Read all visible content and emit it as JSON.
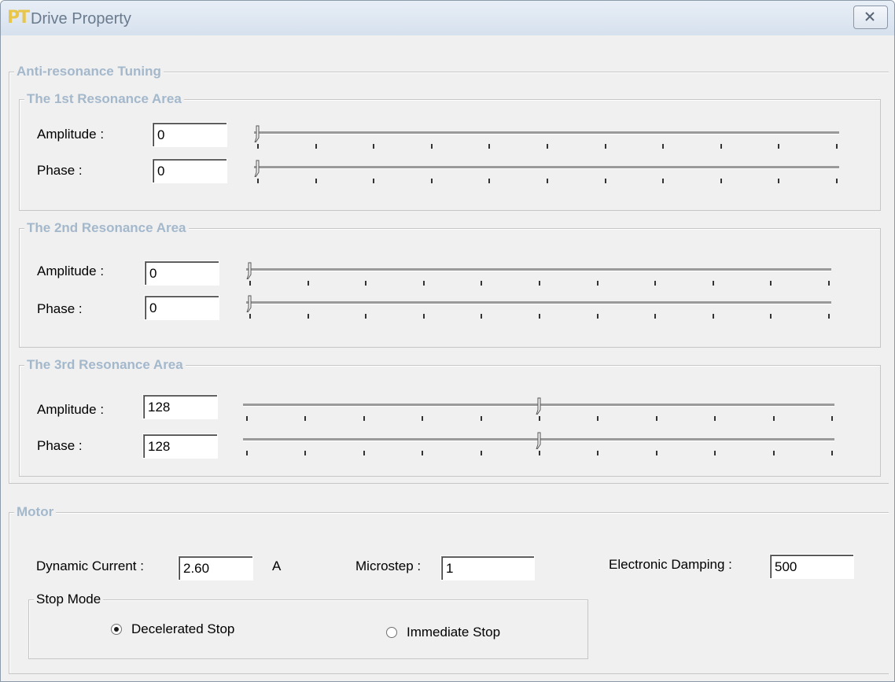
{
  "window": {
    "title": "Drive Property",
    "app_icon_text": "PT"
  },
  "anti_resonance": {
    "title": "Anti-resonance Tuning",
    "areas": [
      {
        "title": "The 1st Resonance Area",
        "amplitude_label": "Amplitude :",
        "amplitude_value": "0",
        "amplitude_level": 0.0,
        "phase_label": "Phase :",
        "phase_value": "0",
        "phase_level": 0.0
      },
      {
        "title": "The 2nd Resonance Area",
        "amplitude_label": "Amplitude :",
        "amplitude_value": "0",
        "amplitude_level": 0.0,
        "phase_label": "Phase :",
        "phase_value": "0",
        "phase_level": 0.0
      },
      {
        "title": "The 3rd Resonance Area",
        "amplitude_label": "Amplitude :",
        "amplitude_value": "128",
        "amplitude_level": 0.5,
        "phase_label": "Phase :",
        "phase_value": "128",
        "phase_level": 0.5
      }
    ]
  },
  "motor": {
    "title": "Motor",
    "dynamic_current_label": "Dynamic Current :",
    "dynamic_current_value": "2.60",
    "dynamic_current_unit": "A",
    "microstep_label": "Microstep :",
    "microstep_value": "1",
    "damping_label": "Electronic Damping :",
    "damping_value": "500",
    "stop_mode": {
      "title": "Stop Mode",
      "options": [
        "Decelerated Stop",
        "Immediate Stop"
      ],
      "selected": "Decelerated Stop"
    }
  },
  "colors": {
    "group_title": "#a4b8cc",
    "title_text": "#6a7b8e"
  }
}
